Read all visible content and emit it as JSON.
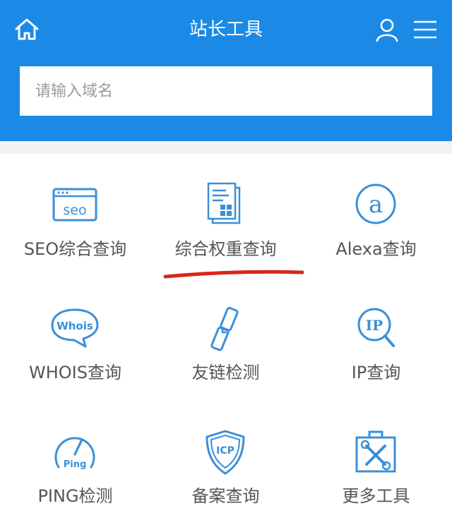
{
  "header": {
    "title": "站长工具",
    "home_icon": "home-icon",
    "user_icon": "user-icon",
    "menu_icon": "menu-icon",
    "background_color": "#1a8ae6"
  },
  "search": {
    "placeholder": "请输入域名",
    "value": ""
  },
  "tools": [
    {
      "label": "SEO综合查询",
      "icon": "seo-icon"
    },
    {
      "label": "综合权重查询",
      "icon": "weight-icon"
    },
    {
      "label": "Alexa查询",
      "icon": "alexa-icon"
    },
    {
      "label": "WHOIS查询",
      "icon": "whois-icon"
    },
    {
      "label": "友链检测",
      "icon": "link-icon"
    },
    {
      "label": "IP查询",
      "icon": "ip-icon"
    },
    {
      "label": "PING检测",
      "icon": "ping-icon"
    },
    {
      "label": "备案查询",
      "icon": "icp-icon"
    },
    {
      "label": "更多工具",
      "icon": "toolbox-icon"
    }
  ],
  "icon_text": {
    "seo": "seo",
    "alexa": "a",
    "whois": "Whois",
    "ip": "IP",
    "ping": "Ping",
    "icp": "ICP"
  },
  "colors": {
    "accent": "#1a8ae6",
    "icon": "#3a8fd8",
    "annotation": "#d9261c"
  }
}
